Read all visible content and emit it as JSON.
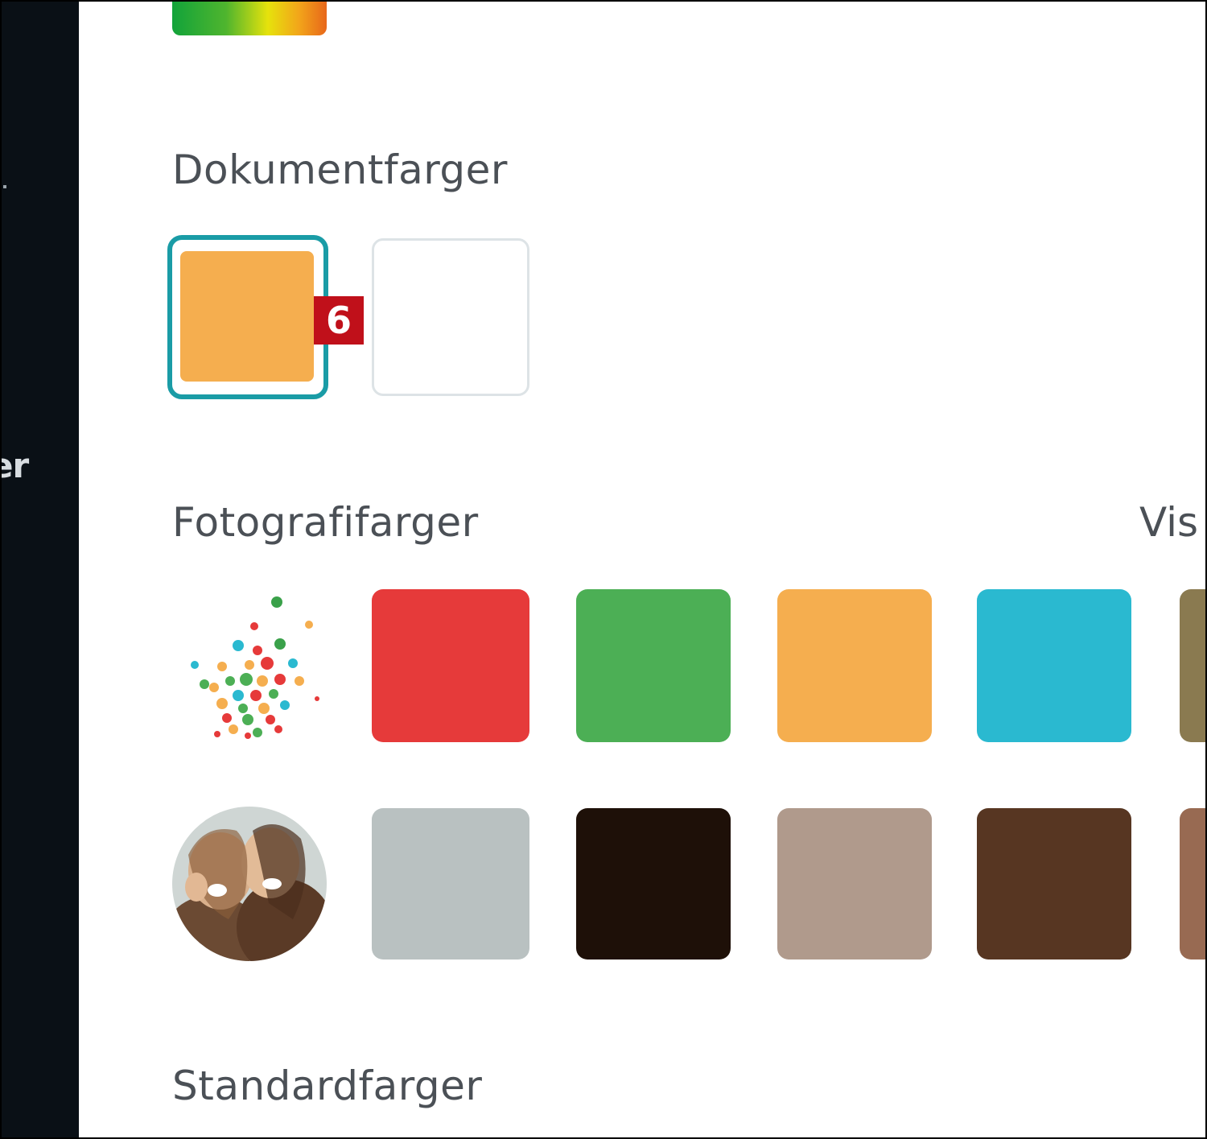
{
  "sidebar": {
    "partial_label": "er"
  },
  "sections": {
    "document_colors": {
      "title": "Dokumentfarger",
      "selected_color": "#f5ae4f",
      "usage_badge": "6",
      "second_color": "#ffffff"
    },
    "photo_colors": {
      "title": "Fotografifarger",
      "view_link": "Vis",
      "rows": [
        {
          "thumbnail": "confetti-photo-thumbnail",
          "colors": [
            "#e63a3a",
            "#4caf55",
            "#f5ae4f",
            "#2ab9d0",
            "#8a7a50"
          ]
        },
        {
          "thumbnail": "two-women-photo-thumbnail",
          "colors": [
            "#b9c1c1",
            "#1e1008",
            "#b09a8c",
            "#573622",
            "#986a52"
          ]
        }
      ]
    },
    "standard_colors": {
      "title": "Standardfarger"
    }
  },
  "accent": "#1a9ca6",
  "badge_color": "#c0101a"
}
